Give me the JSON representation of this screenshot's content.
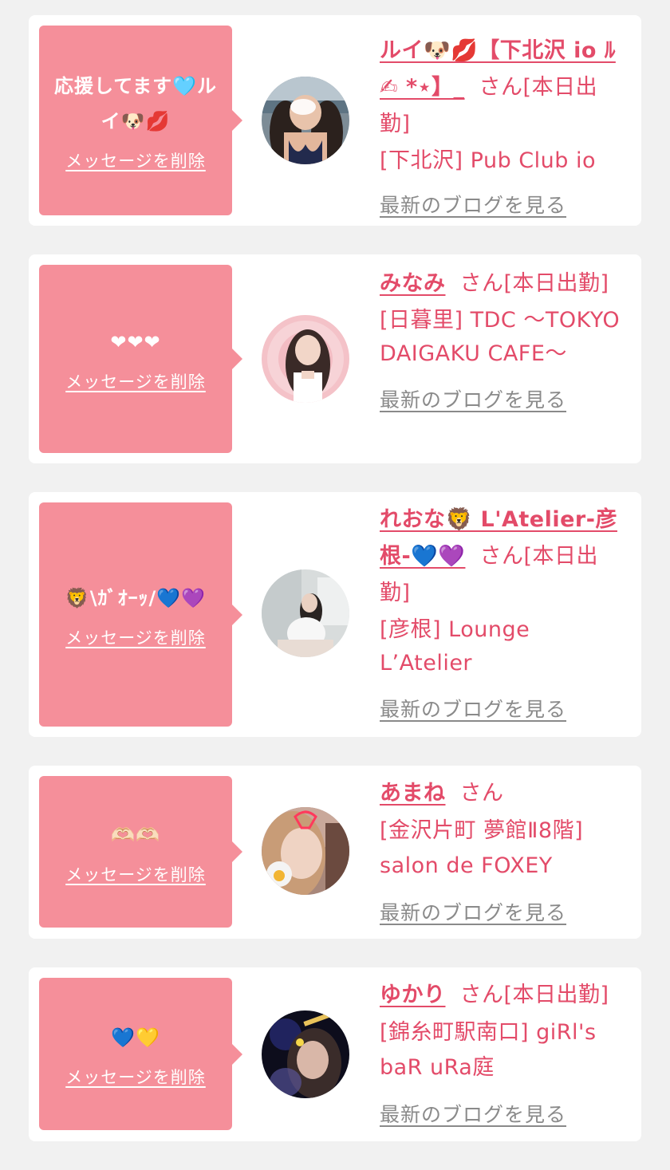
{
  "common": {
    "delete_label": "メッセージを削除",
    "blog_label": "最新のブログを見る",
    "san_label": "さん"
  },
  "cards": [
    {
      "message": "応援してます🩵ルイ🐶💋",
      "name": "ルイ🐶💋【下北沢 io ﾙ✍︎︎ *⋆】_",
      "status": "[本日出勤]",
      "location": "[下北沢] Pub Club io",
      "avatar_icon": "woman-portrait-harbor"
    },
    {
      "message": "❤❤❤",
      "name": "みなみ",
      "status": "[本日出勤]",
      "location": "[日暮里] TDC 〜TOKYO DAIGAKU CAFE〜",
      "avatar_icon": "woman-portrait-pink"
    },
    {
      "message": "🦁\\ｶﾞｵｰｯ/💙💜",
      "name": "れおな🦁 L'Atelier-彦根-💙💜",
      "status": "[本日出勤]",
      "location": "[彦根] Lounge L’Atelier",
      "avatar_icon": "woman-portrait-white"
    },
    {
      "message": "🫶🏻🫶🏻",
      "name": "あまね",
      "status": "",
      "location": "[金沢片町 夢館Ⅱ8階] salon de FOXEY",
      "avatar_icon": "woman-portrait-selfie"
    },
    {
      "message": "💙💛",
      "name": "ゆかり",
      "status": "[本日出勤]",
      "location": "[錦糸町駅南口] giRl's baR uRa庭",
      "avatar_icon": "woman-portrait-dark"
    }
  ],
  "colors": {
    "accent": "#e34b69",
    "bubble": "#f58f9a",
    "background": "#f1f1f1",
    "link_gray": "#8a8a8a"
  }
}
